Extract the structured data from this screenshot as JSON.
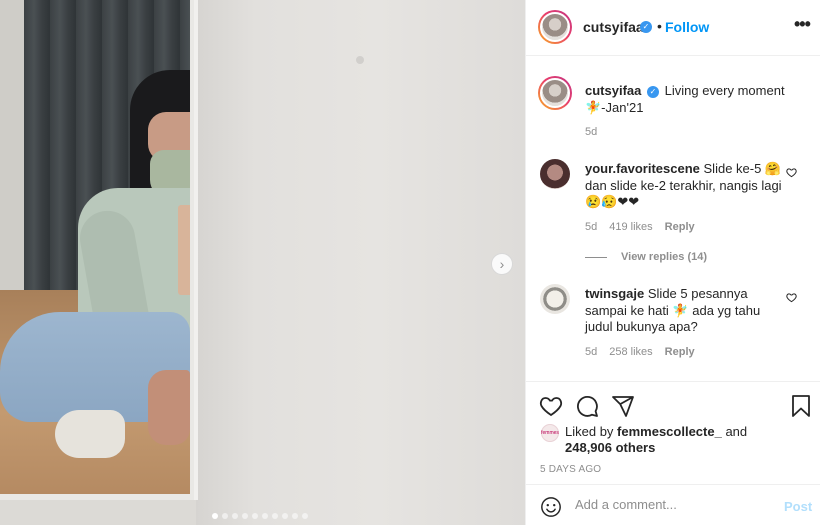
{
  "post": {
    "username": "cutsyifaa",
    "follow_label": "Follow",
    "separator": "•",
    "more_icon": "more-horizontal-icon",
    "verified_glyph": "✓",
    "next_glyph": "›",
    "carousel": {
      "slides": 10,
      "active_index": 0
    }
  },
  "caption": {
    "username": "cutsyifaa",
    "text": "Living every moment🧚-Jan'21",
    "age": "5d"
  },
  "comments": [
    {
      "username": "your.favoritescene",
      "text": "Slide ke-5 🤗 dan slide ke-2 terakhir, nangis lagi😢😥❤❤",
      "age": "5d",
      "likes": "419 likes",
      "reply_label": "Reply",
      "view_replies": "View replies (14)"
    },
    {
      "username": "twinsgaje",
      "text": "Slide 5 pesannya sampai ke hati 🧚 ada yg tahu judul bukunya apa?",
      "age": "5d",
      "likes": "258 likes",
      "reply_label": "Reply"
    }
  ],
  "likes": {
    "prefix": "Liked by",
    "user": "femmescollecte_",
    "middle": "and",
    "others": "248,906 others"
  },
  "timestamp": "5 DAYS AGO",
  "add_comment": {
    "placeholder": "Add a comment...",
    "post_label": "Post"
  },
  "icons": {
    "heart": "heart-icon",
    "comment": "comment-icon",
    "share": "share-icon",
    "save": "bookmark-icon",
    "emoji": "emoji-icon"
  },
  "colors": {
    "link_blue": "#0095f6",
    "post_disabled": "#b2dffc",
    "muted": "#8e8e8e",
    "text": "#262626"
  }
}
